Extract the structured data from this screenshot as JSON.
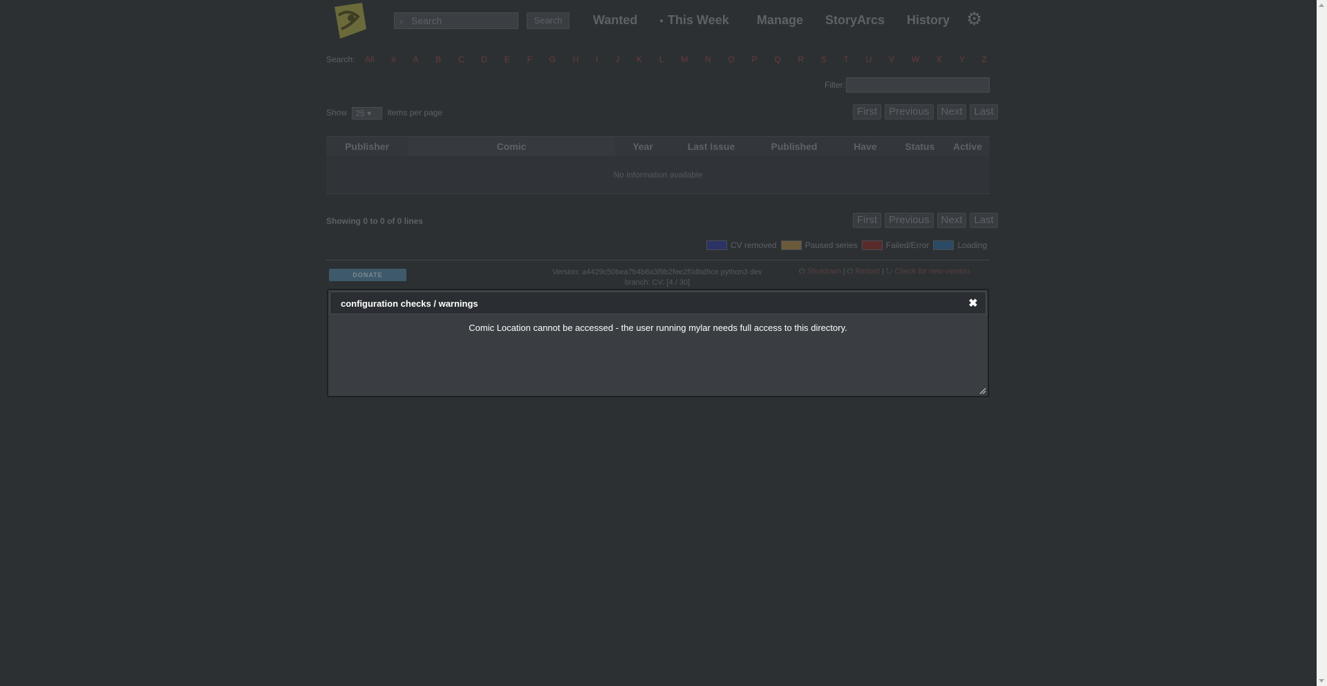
{
  "header": {
    "search_placeholder": "Search",
    "search_button": "Search",
    "nav": [
      "Wanted",
      "This Week",
      "Manage",
      "StoryArcs",
      "History"
    ]
  },
  "alphabet": {
    "label": "Search:",
    "letters": [
      "All",
      "#",
      "A",
      "B",
      "C",
      "D",
      "E",
      "F",
      "G",
      "H",
      "I",
      "J",
      "K",
      "L",
      "M",
      "N",
      "O",
      "P",
      "Q",
      "R",
      "S",
      "T",
      "U",
      "V",
      "W",
      "X",
      "Y",
      "Z"
    ]
  },
  "filter": {
    "label": "Filter:"
  },
  "length": {
    "show": "Show",
    "value": "25",
    "suffix": "items per page"
  },
  "pager": {
    "first": "First",
    "previous": "Previous",
    "next": "Next",
    "last": "Last"
  },
  "table": {
    "columns": [
      "Publisher",
      "Comic",
      "Year",
      "Last Issue",
      "Published",
      "Have",
      "Status",
      "Active"
    ],
    "empty": "No information available"
  },
  "info": "Showing 0 to 0 of 0 lines",
  "legend": {
    "items": [
      {
        "label": "CV removed",
        "color": "#2b3266"
      },
      {
        "label": "Paused series",
        "color": "#6b5a3a"
      },
      {
        "label": "Failed/Error",
        "color": "#5a2a2a"
      },
      {
        "label": "Loading",
        "color": "#2a4a66"
      }
    ]
  },
  "footer": {
    "donate": "DONATE",
    "version_line1": "Version: a4429c50bea7b4b8a3f9b2fee2f0dbd9ce python3 dev",
    "version_line2": "branch: CV: [4 / 30]",
    "links": [
      "Shutdown",
      "Restart",
      "Check for new version"
    ]
  },
  "dialog": {
    "title": "configuration checks / warnings",
    "message": "Comic Location cannot be accessed - the user running mylar needs full access to this directory."
  }
}
